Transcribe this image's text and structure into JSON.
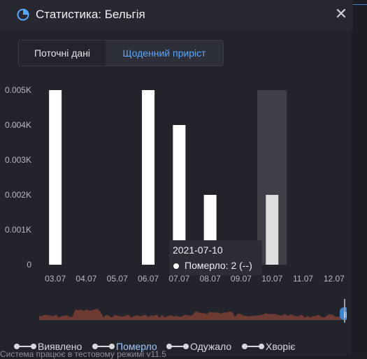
{
  "window": {
    "title": "Статистика: Бельгія",
    "close_label": "✕"
  },
  "tabs": [
    {
      "label": "Поточні дані",
      "active": false
    },
    {
      "label": "Щоденний приріст",
      "active": true
    }
  ],
  "chart_data": {
    "type": "bar",
    "categories": [
      "03.07",
      "04.07",
      "05.07",
      "06.07",
      "07.07",
      "08.07",
      "09.07",
      "10.07",
      "11.07",
      "12.07"
    ],
    "series": [
      {
        "values": [
          0.005,
          0,
          0,
          0.005,
          0.004,
          0.002,
          0,
          0.002,
          0,
          0
        ]
      }
    ],
    "y_ticks": [
      "0",
      "0.001K",
      "0.002K",
      "0.003K",
      "0.004K",
      "0.005K"
    ],
    "ylim": [
      0,
      0.005
    ],
    "highlighted_category": "10.07"
  },
  "tooltip": {
    "date": "2021-07-10",
    "text": "Померло: 2 (--)"
  },
  "legend": [
    {
      "label": "Виявлено",
      "active": false
    },
    {
      "label": "Померло",
      "active": true
    },
    {
      "label": "Одужало",
      "active": false
    },
    {
      "label": "Хворіє",
      "active": false
    }
  ],
  "navigator_handle_label": "||",
  "status_text": "Система працює в тестовому режимі v11.5",
  "colors": {
    "accent": "#57a8ff",
    "bar": "#ffffff",
    "highlight_band": "#4a4b52",
    "navigator_fill": "#7a3f32"
  }
}
